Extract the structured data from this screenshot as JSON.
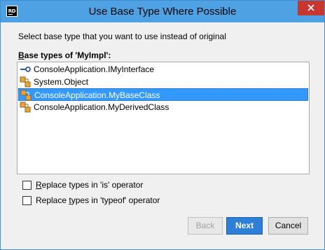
{
  "window": {
    "title": "Use Base Type Where Possible",
    "app_icon_text": "RD"
  },
  "dialog": {
    "instruction": "Select base type that you want to use instead of original",
    "list_label_prefix": "B",
    "list_label_rest": "ase types of 'MyImpl':",
    "items": [
      {
        "label": "ConsoleApplication.IMyInterface",
        "icon": "interface-icon",
        "selected": false
      },
      {
        "label": "System.Object",
        "icon": "class-icon",
        "selected": false
      },
      {
        "label": "ConsoleApplication.MyBaseClass",
        "icon": "class-icon",
        "selected": true
      },
      {
        "label": "ConsoleApplication.MyDerivedClass",
        "icon": "class-icon",
        "selected": false
      }
    ],
    "options": [
      {
        "label_prefix": "",
        "accel": "R",
        "label_rest": "eplace types in 'is' operator",
        "checked": false
      },
      {
        "label_prefix": "Replace ",
        "accel": "t",
        "label_rest": "ypes in 'typeof' operator",
        "checked": false
      }
    ],
    "buttons": {
      "back": "Back",
      "next": "Next",
      "cancel": "Cancel"
    }
  },
  "colors": {
    "titlebar": "#4ea2e4",
    "selection": "#3399ff",
    "close": "#c7372f",
    "primary": "#2e7fd8"
  }
}
